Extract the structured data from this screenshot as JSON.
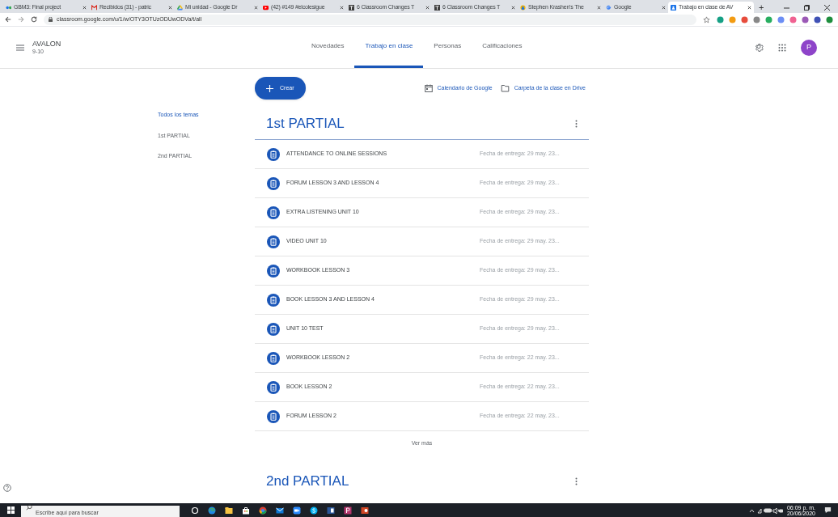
{
  "browser": {
    "tabs": [
      {
        "title": "GBM3: Final project",
        "selected": false
      },
      {
        "title": "Recibidos (31) - patric",
        "selected": false
      },
      {
        "title": "Mi unidad - Google Dr",
        "selected": false
      },
      {
        "title": "(42) #149 #elcolesigue",
        "selected": false
      },
      {
        "title": "6 Classroom Changes T",
        "selected": false
      },
      {
        "title": "6 Classroom Changes T",
        "selected": false
      },
      {
        "title": "Stephen Krashen's The",
        "selected": false
      },
      {
        "title": "Google",
        "selected": false
      },
      {
        "title": "Trabajo en clase de AV",
        "selected": true
      }
    ],
    "new_tab": "+",
    "url": "classroom.google.com/u/1/w/OTY3OTUzODUwODVa/t/all"
  },
  "class": {
    "name": "AVALON",
    "section": "9-10"
  },
  "nav_tabs": [
    {
      "label": "Novedades",
      "selected": false
    },
    {
      "label": "Trabajo en clase",
      "selected": true
    },
    {
      "label": "Personas",
      "selected": false
    },
    {
      "label": "Calificaciones",
      "selected": false
    }
  ],
  "avatar": "P",
  "create_button": "Crear",
  "links": [
    {
      "label": "Calendario de Google",
      "kind": "calendar"
    },
    {
      "label": "Carpeta de la clase en Drive",
      "kind": "folder"
    }
  ],
  "topics": [
    {
      "label": "Todos los temas",
      "selected": true
    },
    {
      "label": "1st PARTIAL",
      "selected": false
    },
    {
      "label": "2nd PARTIAL",
      "selected": false
    }
  ],
  "sections": [
    {
      "title": "1st PARTIAL",
      "items": [
        {
          "title": "ATTENDANCE TO ONLINE SESSIONS",
          "due": "Fecha de entrega: 29 may. 23..."
        },
        {
          "title": "FORUM LESSON 3 AND LESSON 4",
          "due": "Fecha de entrega: 29 may. 23..."
        },
        {
          "title": "EXTRA LISTENING UNIT 10",
          "due": "Fecha de entrega: 29 may. 23..."
        },
        {
          "title": "VIDEO UNIT 10",
          "due": "Fecha de entrega: 29 may. 23..."
        },
        {
          "title": "WORKBOOK LESSON 3",
          "due": "Fecha de entrega: 29 may. 23..."
        },
        {
          "title": "BOOK LESSON 3 AND LESSON 4",
          "due": "Fecha de entrega: 29 may. 23..."
        },
        {
          "title": "UNIT 10 TEST",
          "due": "Fecha de entrega: 29 may. 23..."
        },
        {
          "title": "WORKBOOK LESSON 2",
          "due": "Fecha de entrega: 22 may. 23..."
        },
        {
          "title": "BOOK LESSON 2",
          "due": "Fecha de entrega: 22 may. 23..."
        },
        {
          "title": "FORUM LESSON 2",
          "due": "Fecha de entrega: 22 may. 23..."
        }
      ],
      "more": "Ver más"
    },
    {
      "title": "2nd PARTIAL"
    }
  ],
  "taskbar": {
    "search_placeholder": "Escribe aquí para buscar",
    "time": "06:09 p. m.",
    "date": "20/06/2020"
  }
}
